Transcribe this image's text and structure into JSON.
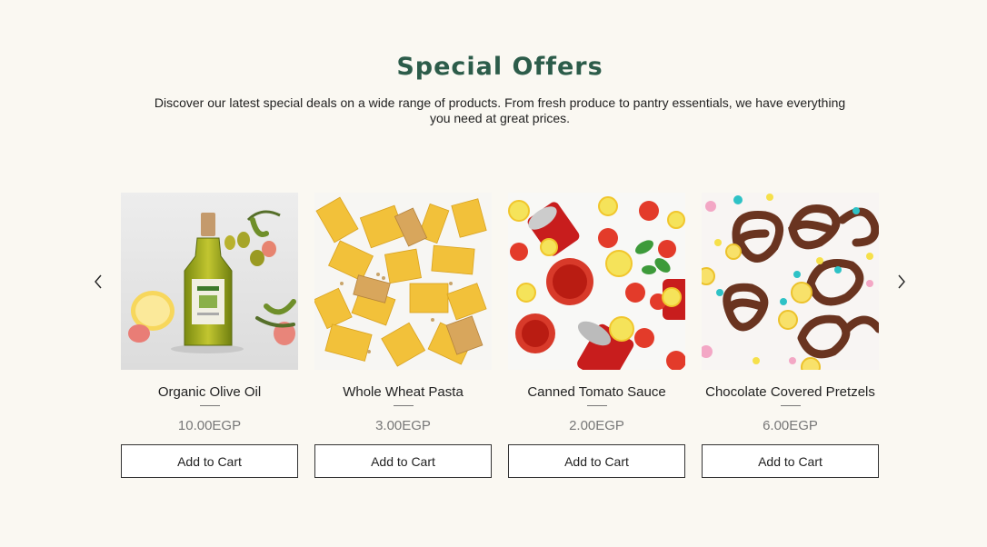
{
  "section": {
    "title": "Special Offers",
    "description": "Discover our latest special deals on a wide range of products. From fresh produce to pantry essentials, we have everything you need at great prices."
  },
  "carousel": {
    "prev_icon": "chevron-left-icon",
    "next_icon": "chevron-right-icon"
  },
  "products": [
    {
      "name": "Organic Olive Oil",
      "price": "10.00EGP",
      "button": "Add to Cart",
      "image": "olive-oil-bottle"
    },
    {
      "name": "Whole Wheat Pasta",
      "price": "3.00EGP",
      "button": "Add to Cart",
      "image": "pasta-bundles"
    },
    {
      "name": "Canned Tomato Sauce",
      "price": "2.00EGP",
      "button": "Add to Cart",
      "image": "tomato-sauce-cans"
    },
    {
      "name": "Chocolate Covered Pretzels",
      "price": "6.00EGP",
      "button": "Add to Cart",
      "image": "chocolate-pretzels"
    }
  ],
  "colors": {
    "background": "#faf8f2",
    "title": "#2c5c4a",
    "price": "#777777"
  }
}
